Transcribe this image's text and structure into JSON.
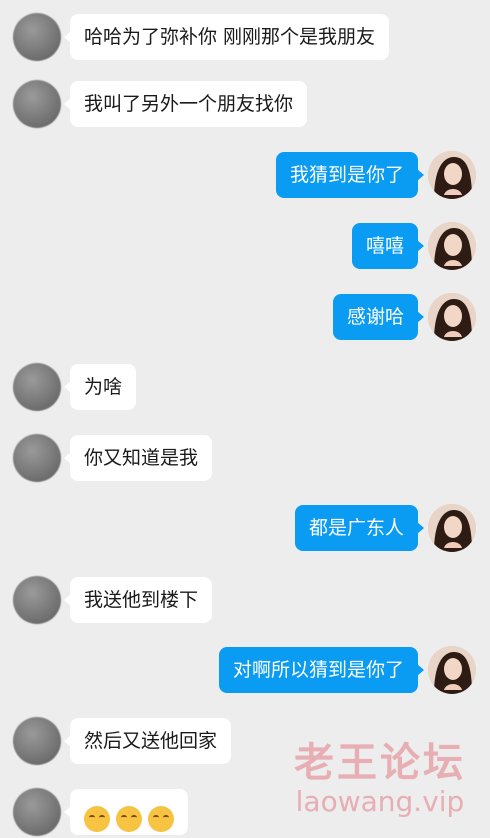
{
  "messages": [
    {
      "side": "in",
      "text": "哈哈为了弥补你 刚刚那个是我朋友"
    },
    {
      "side": "in",
      "text": "我叫了另外一个朋友找你"
    },
    {
      "side": "out",
      "text": "我猜到是你了"
    },
    {
      "side": "out",
      "text": "嘻嘻"
    },
    {
      "side": "out",
      "text": "感谢哈"
    },
    {
      "side": "in",
      "text": "为啥"
    },
    {
      "side": "in",
      "text": "你又知道是我"
    },
    {
      "side": "out",
      "text": "都是广东人"
    },
    {
      "side": "in",
      "text": "我送他到楼下"
    },
    {
      "side": "out",
      "text": "对啊所以猜到是你了"
    },
    {
      "side": "in",
      "text": "然后又送他回家"
    },
    {
      "side": "in",
      "text": "😊😊😊",
      "emoji_count": 3
    }
  ],
  "watermark": {
    "title": "老王论坛",
    "url": "laowang.vip"
  },
  "colors": {
    "background": "#ededed",
    "outgoing_bubble": "#0a9cf3",
    "incoming_bubble": "#ffffff",
    "watermark": "#e7a4ab"
  }
}
